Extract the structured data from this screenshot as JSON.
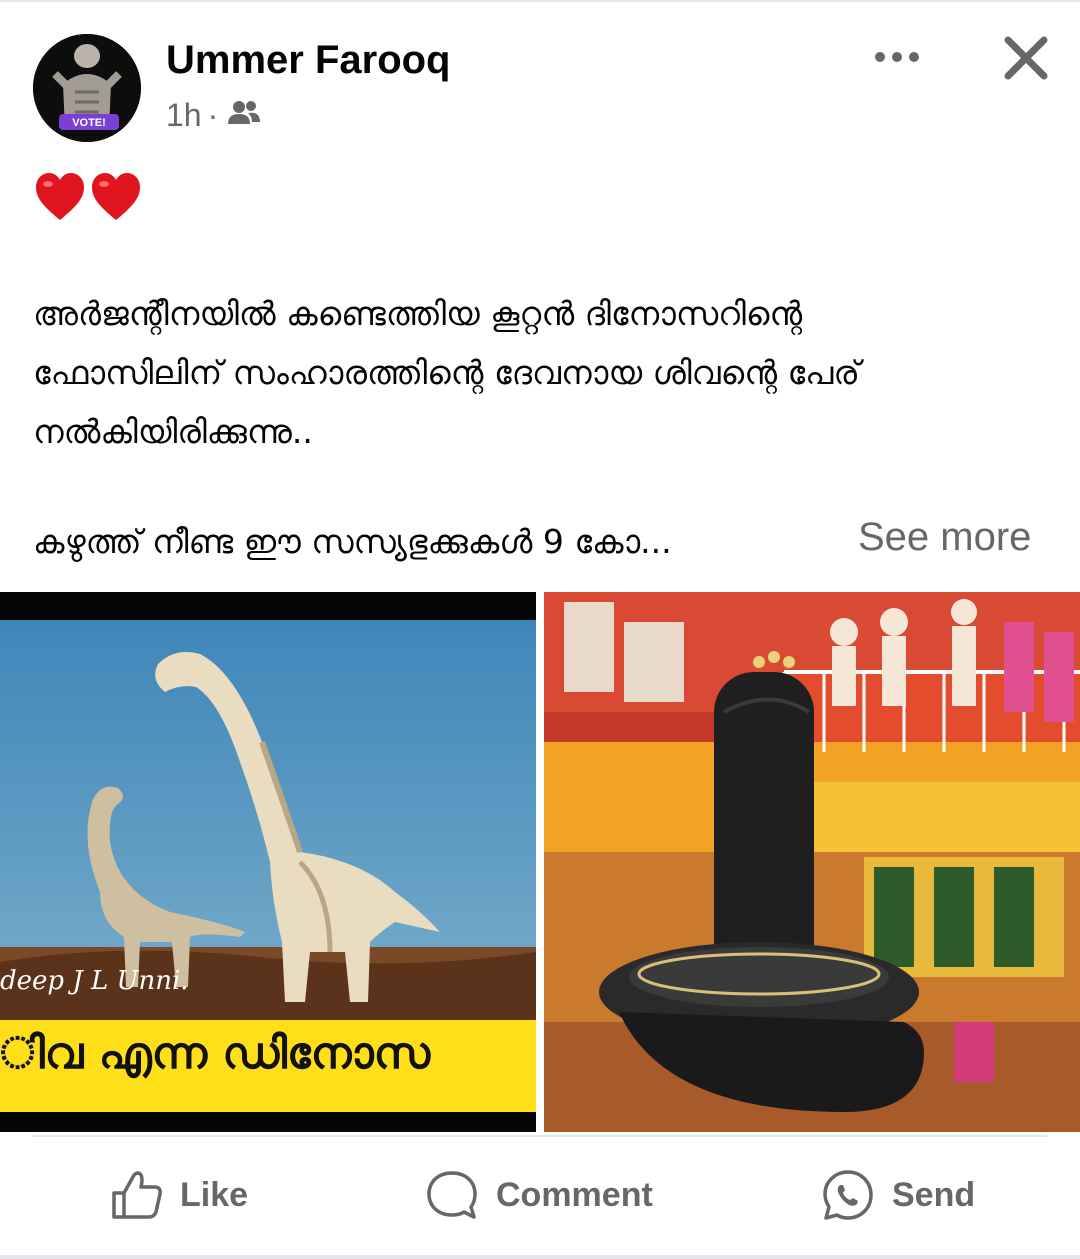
{
  "post": {
    "author": "Ummer Farooq",
    "time": "1h",
    "separator": "·",
    "audience_icon": "friends-icon",
    "avatar_badge": "VOTE!",
    "reaction_emoji": "❤❤",
    "text_lines": [
      "അർജന്റീനയിൽ കണ്ടെത്തിയ കൂറ്റൻ ദിനോസറിന്റെ",
      "ഫോസിലിന് സംഹാരത്തിന്റെ ദേവനായ ശിവന്റെ പേര്",
      "നൽകിയിരിക്കുന്നു.."
    ],
    "text_line_2": "കഴുത്ത് നീണ്ട ഈ സസ്യഭുക്കുകൾ 9 കോ...",
    "see_more": "See more"
  },
  "images": {
    "left": {
      "watermark": "deep J L Unni.",
      "caption": "ിവ എന്ന ഡിനോസ"
    }
  },
  "actions": {
    "like": "Like",
    "comment": "Comment",
    "send": "Send"
  },
  "colors": {
    "text_primary": "#050505",
    "text_secondary": "#65676b",
    "caption_yellow": "#ffdf1a"
  }
}
